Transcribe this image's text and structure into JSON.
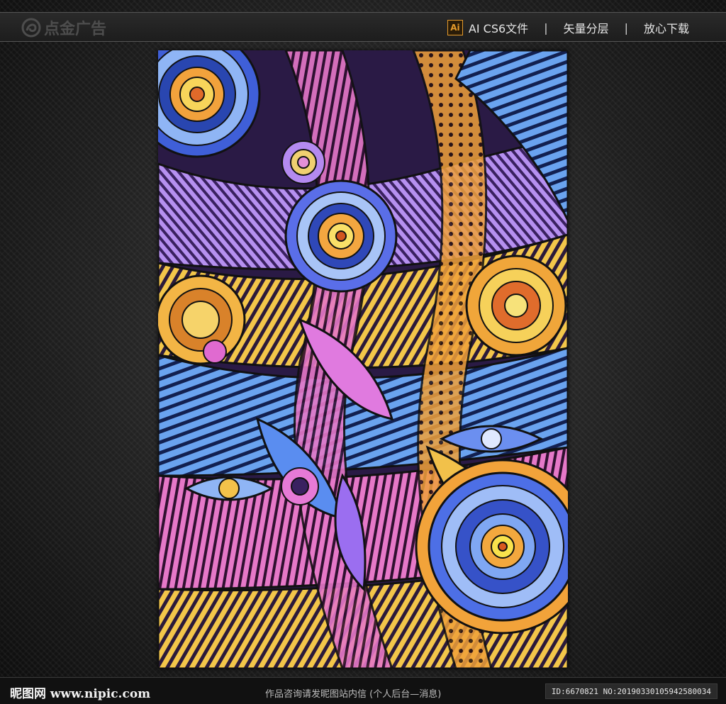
{
  "header": {
    "logo_text": "点金广告",
    "badge_text": "Ai",
    "format_label": "AI CS6文件",
    "separator": "|",
    "feature_layers": "矢量分层",
    "feature_download": "放心下载"
  },
  "footer": {
    "site_logo": "昵图网 www.nipic.com",
    "notice": "作品咨询请发昵图站内信 (个人后台—消息)",
    "id_text": "ID:6670821 NO:20190330105942580034"
  },
  "colors": {
    "accent_orange": "#e59a2a",
    "bar_background": "#222222"
  },
  "icons": {
    "logo": "swirl-logo-icon",
    "format": "adobe-illustrator-icon"
  }
}
